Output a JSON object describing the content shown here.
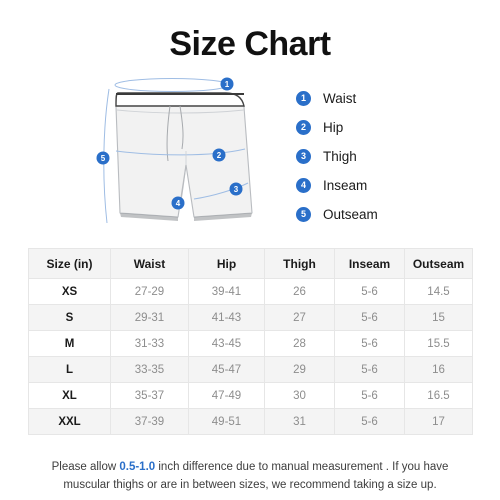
{
  "title": "Size Chart",
  "legend": {
    "items": [
      {
        "number": "1",
        "label": "Waist"
      },
      {
        "number": "2",
        "label": "Hip"
      },
      {
        "number": "3",
        "label": "Thigh"
      },
      {
        "number": "4",
        "label": "Inseam"
      },
      {
        "number": "5",
        "label": "Outseam"
      }
    ]
  },
  "diagram": {
    "markers": [
      {
        "number": "1",
        "measure": "Waist"
      },
      {
        "number": "2",
        "measure": "Hip"
      },
      {
        "number": "3",
        "measure": "Thigh"
      },
      {
        "number": "4",
        "measure": "Inseam"
      },
      {
        "number": "5",
        "measure": "Outseam"
      }
    ]
  },
  "table": {
    "headers": [
      "Size (in)",
      "Waist",
      "Hip",
      "Thigh",
      "Inseam",
      "Outseam"
    ],
    "rows": [
      {
        "size": "XS",
        "waist": "27-29",
        "hip": "39-41",
        "thigh": "26",
        "inseam": "5-6",
        "outseam": "14.5"
      },
      {
        "size": "S",
        "waist": "29-31",
        "hip": "41-43",
        "thigh": "27",
        "inseam": "5-6",
        "outseam": "15"
      },
      {
        "size": "M",
        "waist": "31-33",
        "hip": "43-45",
        "thigh": "28",
        "inseam": "5-6",
        "outseam": "15.5"
      },
      {
        "size": "L",
        "waist": "33-35",
        "hip": "45-47",
        "thigh": "29",
        "inseam": "5-6",
        "outseam": "16"
      },
      {
        "size": "XL",
        "waist": "35-37",
        "hip": "47-49",
        "thigh": "30",
        "inseam": "5-6",
        "outseam": "16.5"
      },
      {
        "size": "XXL",
        "waist": "37-39",
        "hip": "49-51",
        "thigh": "31",
        "inseam": "5-6",
        "outseam": "17"
      }
    ]
  },
  "footer": {
    "text_before": "Please allow ",
    "highlight": "0.5-1.0",
    "text_after": " inch difference due to manual measurement . If you have muscular thighs or are in between sizes, we recommend taking a size up."
  },
  "colors": {
    "accent_blue": "#2a6fc9",
    "garment_fill": "#f2f2f2",
    "garment_stroke": "#b9bcc0",
    "row_shade": "#f4f4f4",
    "value_text": "#8d8d8d"
  }
}
